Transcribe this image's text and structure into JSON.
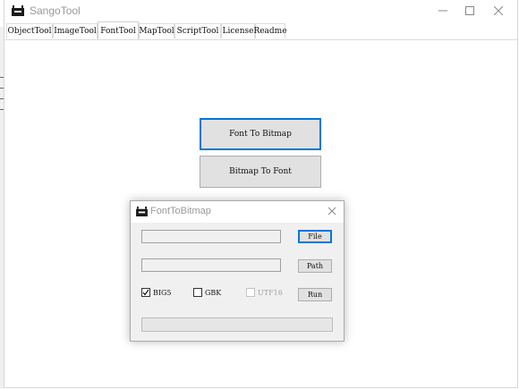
{
  "window": {
    "title": "SangoTool"
  },
  "tabs": [
    {
      "label": "ObjectTool",
      "active": false
    },
    {
      "label": "ImageTool",
      "active": false
    },
    {
      "label": "FontTool",
      "active": true
    },
    {
      "label": "MapTool",
      "active": false
    },
    {
      "label": "ScriptTool",
      "active": false
    },
    {
      "label": "License",
      "active": false
    },
    {
      "label": "Readme",
      "active": false
    }
  ],
  "font_tool": {
    "font_to_bitmap_label": "Font To Bitmap",
    "bitmap_to_font_label": "Bitmap To Font"
  },
  "dialog": {
    "title": "FontToBitmap",
    "file_input": {
      "value": ""
    },
    "path_input": {
      "value": ""
    },
    "file_button_label": "File",
    "path_button_label": "Path",
    "run_button_label": "Run",
    "checkboxes": [
      {
        "label": "BIG5",
        "checked": true,
        "enabled": true
      },
      {
        "label": "GBK",
        "checked": false,
        "enabled": true
      },
      {
        "label": "UTF16",
        "checked": false,
        "enabled": false
      }
    ],
    "progress_percent": 0
  },
  "icons": {
    "app": "app-icon",
    "minimize": "minimize-icon",
    "maximize": "maximize-icon",
    "close": "close-icon",
    "checkmark": "checkmark-icon"
  },
  "colors": {
    "focus_border": "#0078d7",
    "button_face": "#e1e1e1",
    "dialog_background": "#f0f0f0"
  }
}
